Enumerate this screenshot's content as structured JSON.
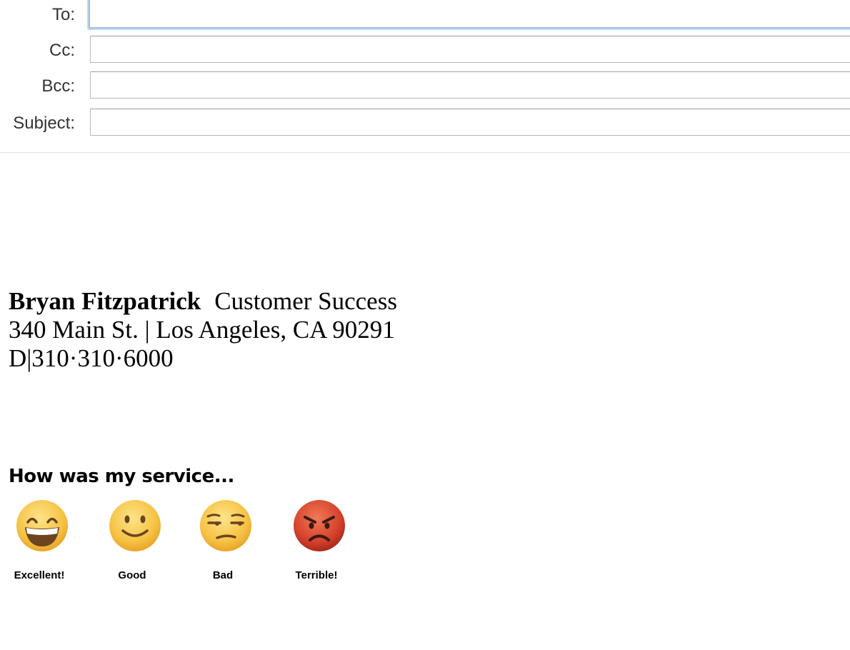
{
  "compose": {
    "fields": [
      {
        "label": "To:",
        "value": ""
      },
      {
        "label": "Cc:",
        "value": ""
      },
      {
        "label": "Bcc:",
        "value": ""
      },
      {
        "label": "Subject:",
        "value": ""
      }
    ]
  },
  "signature": {
    "name": "Bryan Fitzpatrick",
    "title": "Customer Success",
    "address": "340 Main St. | Los Angeles, CA 90291",
    "phone": "D|310·310·6000"
  },
  "survey": {
    "heading": "How was my service...",
    "options": [
      {
        "label": "Excellent!",
        "icon": "grinning-face-icon"
      },
      {
        "label": "Good",
        "icon": "slightly-smiling-face-icon"
      },
      {
        "label": "Bad",
        "icon": "unamused-face-icon"
      },
      {
        "label": "Terrible!",
        "icon": "angry-face-icon"
      }
    ]
  },
  "colors": {
    "focus_ring": "#9fbde6",
    "emoji_yellow": "#f7c64a",
    "emoji_red": "#d6422c"
  }
}
